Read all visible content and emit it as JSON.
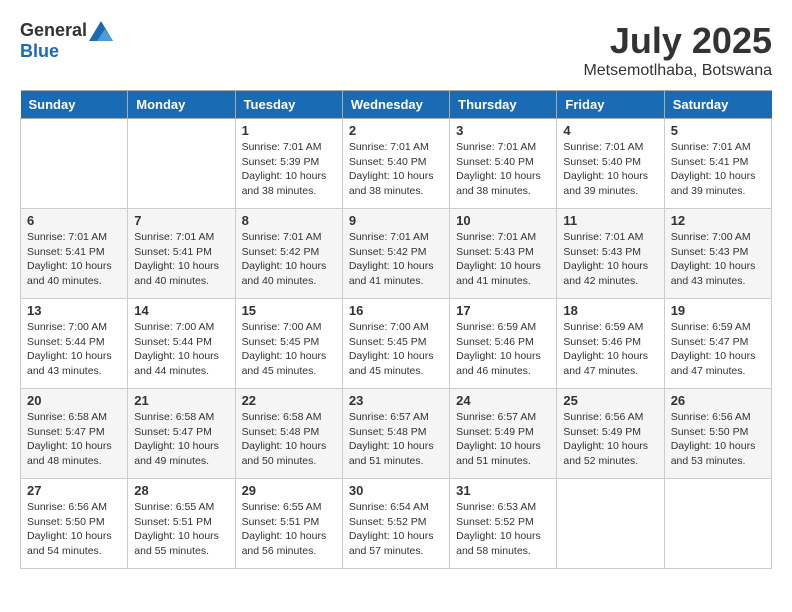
{
  "header": {
    "logo": {
      "general": "General",
      "blue": "Blue"
    },
    "title": "July 2025",
    "location": "Metsemotlhaba, Botswana"
  },
  "days_of_week": [
    "Sunday",
    "Monday",
    "Tuesday",
    "Wednesday",
    "Thursday",
    "Friday",
    "Saturday"
  ],
  "weeks": [
    [
      {
        "day": "",
        "sunrise": "",
        "sunset": "",
        "daylight": ""
      },
      {
        "day": "",
        "sunrise": "",
        "sunset": "",
        "daylight": ""
      },
      {
        "day": "1",
        "sunrise": "Sunrise: 7:01 AM",
        "sunset": "Sunset: 5:39 PM",
        "daylight": "Daylight: 10 hours and 38 minutes."
      },
      {
        "day": "2",
        "sunrise": "Sunrise: 7:01 AM",
        "sunset": "Sunset: 5:40 PM",
        "daylight": "Daylight: 10 hours and 38 minutes."
      },
      {
        "day": "3",
        "sunrise": "Sunrise: 7:01 AM",
        "sunset": "Sunset: 5:40 PM",
        "daylight": "Daylight: 10 hours and 38 minutes."
      },
      {
        "day": "4",
        "sunrise": "Sunrise: 7:01 AM",
        "sunset": "Sunset: 5:40 PM",
        "daylight": "Daylight: 10 hours and 39 minutes."
      },
      {
        "day": "5",
        "sunrise": "Sunrise: 7:01 AM",
        "sunset": "Sunset: 5:41 PM",
        "daylight": "Daylight: 10 hours and 39 minutes."
      }
    ],
    [
      {
        "day": "6",
        "sunrise": "Sunrise: 7:01 AM",
        "sunset": "Sunset: 5:41 PM",
        "daylight": "Daylight: 10 hours and 40 minutes."
      },
      {
        "day": "7",
        "sunrise": "Sunrise: 7:01 AM",
        "sunset": "Sunset: 5:41 PM",
        "daylight": "Daylight: 10 hours and 40 minutes."
      },
      {
        "day": "8",
        "sunrise": "Sunrise: 7:01 AM",
        "sunset": "Sunset: 5:42 PM",
        "daylight": "Daylight: 10 hours and 40 minutes."
      },
      {
        "day": "9",
        "sunrise": "Sunrise: 7:01 AM",
        "sunset": "Sunset: 5:42 PM",
        "daylight": "Daylight: 10 hours and 41 minutes."
      },
      {
        "day": "10",
        "sunrise": "Sunrise: 7:01 AM",
        "sunset": "Sunset: 5:43 PM",
        "daylight": "Daylight: 10 hours and 41 minutes."
      },
      {
        "day": "11",
        "sunrise": "Sunrise: 7:01 AM",
        "sunset": "Sunset: 5:43 PM",
        "daylight": "Daylight: 10 hours and 42 minutes."
      },
      {
        "day": "12",
        "sunrise": "Sunrise: 7:00 AM",
        "sunset": "Sunset: 5:43 PM",
        "daylight": "Daylight: 10 hours and 43 minutes."
      }
    ],
    [
      {
        "day": "13",
        "sunrise": "Sunrise: 7:00 AM",
        "sunset": "Sunset: 5:44 PM",
        "daylight": "Daylight: 10 hours and 43 minutes."
      },
      {
        "day": "14",
        "sunrise": "Sunrise: 7:00 AM",
        "sunset": "Sunset: 5:44 PM",
        "daylight": "Daylight: 10 hours and 44 minutes."
      },
      {
        "day": "15",
        "sunrise": "Sunrise: 7:00 AM",
        "sunset": "Sunset: 5:45 PM",
        "daylight": "Daylight: 10 hours and 45 minutes."
      },
      {
        "day": "16",
        "sunrise": "Sunrise: 7:00 AM",
        "sunset": "Sunset: 5:45 PM",
        "daylight": "Daylight: 10 hours and 45 minutes."
      },
      {
        "day": "17",
        "sunrise": "Sunrise: 6:59 AM",
        "sunset": "Sunset: 5:46 PM",
        "daylight": "Daylight: 10 hours and 46 minutes."
      },
      {
        "day": "18",
        "sunrise": "Sunrise: 6:59 AM",
        "sunset": "Sunset: 5:46 PM",
        "daylight": "Daylight: 10 hours and 47 minutes."
      },
      {
        "day": "19",
        "sunrise": "Sunrise: 6:59 AM",
        "sunset": "Sunset: 5:47 PM",
        "daylight": "Daylight: 10 hours and 47 minutes."
      }
    ],
    [
      {
        "day": "20",
        "sunrise": "Sunrise: 6:58 AM",
        "sunset": "Sunset: 5:47 PM",
        "daylight": "Daylight: 10 hours and 48 minutes."
      },
      {
        "day": "21",
        "sunrise": "Sunrise: 6:58 AM",
        "sunset": "Sunset: 5:47 PM",
        "daylight": "Daylight: 10 hours and 49 minutes."
      },
      {
        "day": "22",
        "sunrise": "Sunrise: 6:58 AM",
        "sunset": "Sunset: 5:48 PM",
        "daylight": "Daylight: 10 hours and 50 minutes."
      },
      {
        "day": "23",
        "sunrise": "Sunrise: 6:57 AM",
        "sunset": "Sunset: 5:48 PM",
        "daylight": "Daylight: 10 hours and 51 minutes."
      },
      {
        "day": "24",
        "sunrise": "Sunrise: 6:57 AM",
        "sunset": "Sunset: 5:49 PM",
        "daylight": "Daylight: 10 hours and 51 minutes."
      },
      {
        "day": "25",
        "sunrise": "Sunrise: 6:56 AM",
        "sunset": "Sunset: 5:49 PM",
        "daylight": "Daylight: 10 hours and 52 minutes."
      },
      {
        "day": "26",
        "sunrise": "Sunrise: 6:56 AM",
        "sunset": "Sunset: 5:50 PM",
        "daylight": "Daylight: 10 hours and 53 minutes."
      }
    ],
    [
      {
        "day": "27",
        "sunrise": "Sunrise: 6:56 AM",
        "sunset": "Sunset: 5:50 PM",
        "daylight": "Daylight: 10 hours and 54 minutes."
      },
      {
        "day": "28",
        "sunrise": "Sunrise: 6:55 AM",
        "sunset": "Sunset: 5:51 PM",
        "daylight": "Daylight: 10 hours and 55 minutes."
      },
      {
        "day": "29",
        "sunrise": "Sunrise: 6:55 AM",
        "sunset": "Sunset: 5:51 PM",
        "daylight": "Daylight: 10 hours and 56 minutes."
      },
      {
        "day": "30",
        "sunrise": "Sunrise: 6:54 AM",
        "sunset": "Sunset: 5:52 PM",
        "daylight": "Daylight: 10 hours and 57 minutes."
      },
      {
        "day": "31",
        "sunrise": "Sunrise: 6:53 AM",
        "sunset": "Sunset: 5:52 PM",
        "daylight": "Daylight: 10 hours and 58 minutes."
      },
      {
        "day": "",
        "sunrise": "",
        "sunset": "",
        "daylight": ""
      },
      {
        "day": "",
        "sunrise": "",
        "sunset": "",
        "daylight": ""
      }
    ]
  ]
}
